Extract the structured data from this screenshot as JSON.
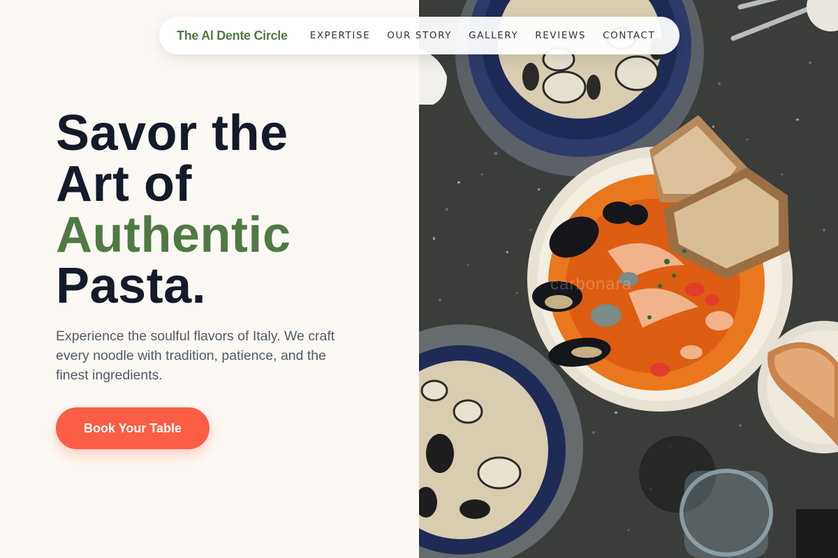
{
  "nav": {
    "brand": "The Al Dente Circle",
    "links": [
      {
        "label": "EXPERTISE"
      },
      {
        "label": "OUR STORY"
      },
      {
        "label": "GALLERY"
      },
      {
        "label": "REVIEWS"
      },
      {
        "label": "CONTACT"
      }
    ]
  },
  "hero": {
    "title_line1": "Savor the",
    "title_line2": "Art of",
    "title_accent": "Authentic",
    "title_line4": "Pasta.",
    "subtitle": "Experience the soulful flavors of Italy. We craft every noodle with tradition, patience, and the finest ingredients.",
    "cta_label": "Book Your Table"
  },
  "image": {
    "subject": "overhead-pasta-seafood-photo",
    "watermark": "carbonara"
  },
  "colors": {
    "background": "#fcf9f4",
    "brand_green": "#4f7a44",
    "heading": "#141a2a",
    "cta": "#fb5d45"
  }
}
